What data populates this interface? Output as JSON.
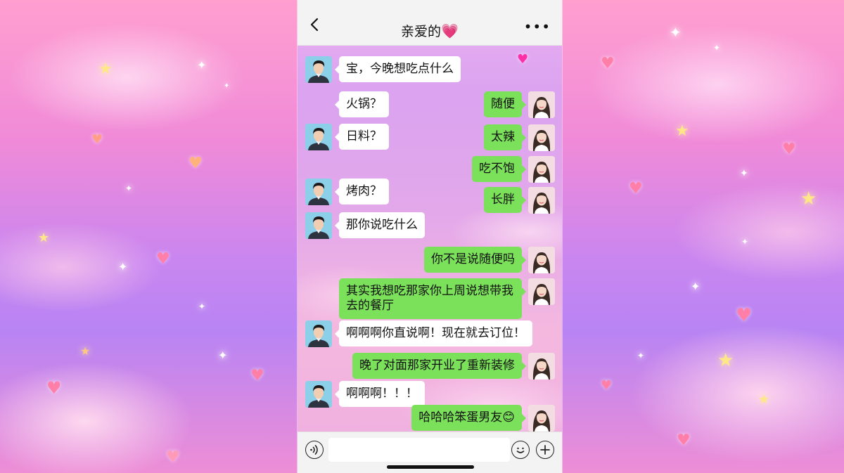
{
  "header": {
    "title": "亲爱的",
    "title_heart": "💗",
    "more": "•••"
  },
  "messages": [
    {
      "from": "boy",
      "text": "宝，今晚想吃点什么"
    },
    {
      "from": "boy",
      "text": "火锅？"
    },
    {
      "from": "girl",
      "text": "随便"
    },
    {
      "from": "boy",
      "text": "日料？"
    },
    {
      "from": "girl",
      "text": "太辣"
    },
    {
      "from": "girl",
      "text": "吃不饱"
    },
    {
      "from": "boy",
      "text": "烤肉？"
    },
    {
      "from": "girl",
      "text": "长胖"
    },
    {
      "from": "boy",
      "text": "那你说吃什么"
    },
    {
      "from": "girl",
      "text": "你不是说随便吗"
    },
    {
      "from": "girl",
      "text": "其实我想吃那家你上周说想带我去的餐厅"
    },
    {
      "from": "boy",
      "text": "啊啊啊你直说啊！现在就去订位！"
    },
    {
      "from": "girl",
      "text": "晚了对面那家开业了重新装修"
    },
    {
      "from": "boy",
      "text": "啊啊啊！！！"
    },
    {
      "from": "girl",
      "text": "哈哈哈笨蛋男友😊"
    }
  ],
  "input": {
    "value": "",
    "voice_icon": "voice-icon",
    "emoji_icon": "emoji-icon",
    "plus_icon": "plus-icon"
  },
  "colors": {
    "sent_bubble": "#7be05a",
    "received_bubble": "#ffffff",
    "title_heart": "#ff2fa8"
  }
}
